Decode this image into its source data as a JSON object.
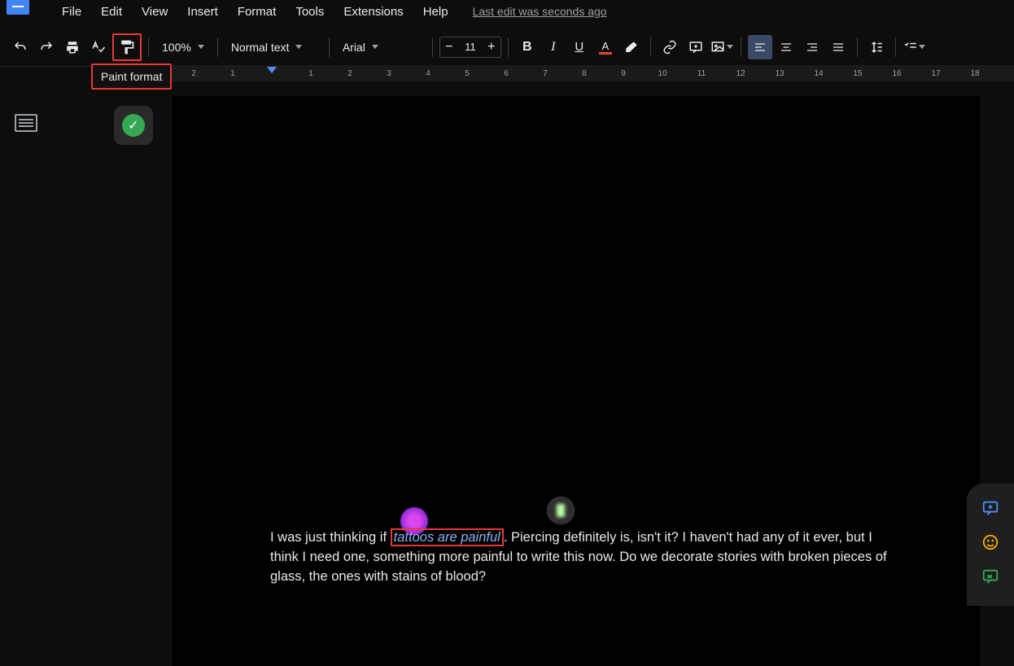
{
  "menu": {
    "items": [
      "File",
      "Edit",
      "View",
      "Insert",
      "Format",
      "Tools",
      "Extensions",
      "Help"
    ],
    "last_edit": "Last edit was seconds ago"
  },
  "toolbar": {
    "zoom": "100%",
    "style": "Normal text",
    "font": "Arial",
    "font_size": "11"
  },
  "tooltip": {
    "paint_format": "Paint format"
  },
  "ruler": [
    "2",
    "1",
    "",
    "1",
    "2",
    "3",
    "4",
    "5",
    "6",
    "7",
    "8",
    "9",
    "10",
    "11",
    "12",
    "13",
    "14",
    "15",
    "16",
    "17",
    "18"
  ],
  "document": {
    "text_before": "I was just thinking if ",
    "highlight": "tattoos are painful",
    "text_after": ". Piercing definitely is, isn't it? I haven't had any of it ever, but I think I need one, something more painful to write this now. Do we decorate stories with broken pieces of glass, the ones with stains of blood?"
  }
}
